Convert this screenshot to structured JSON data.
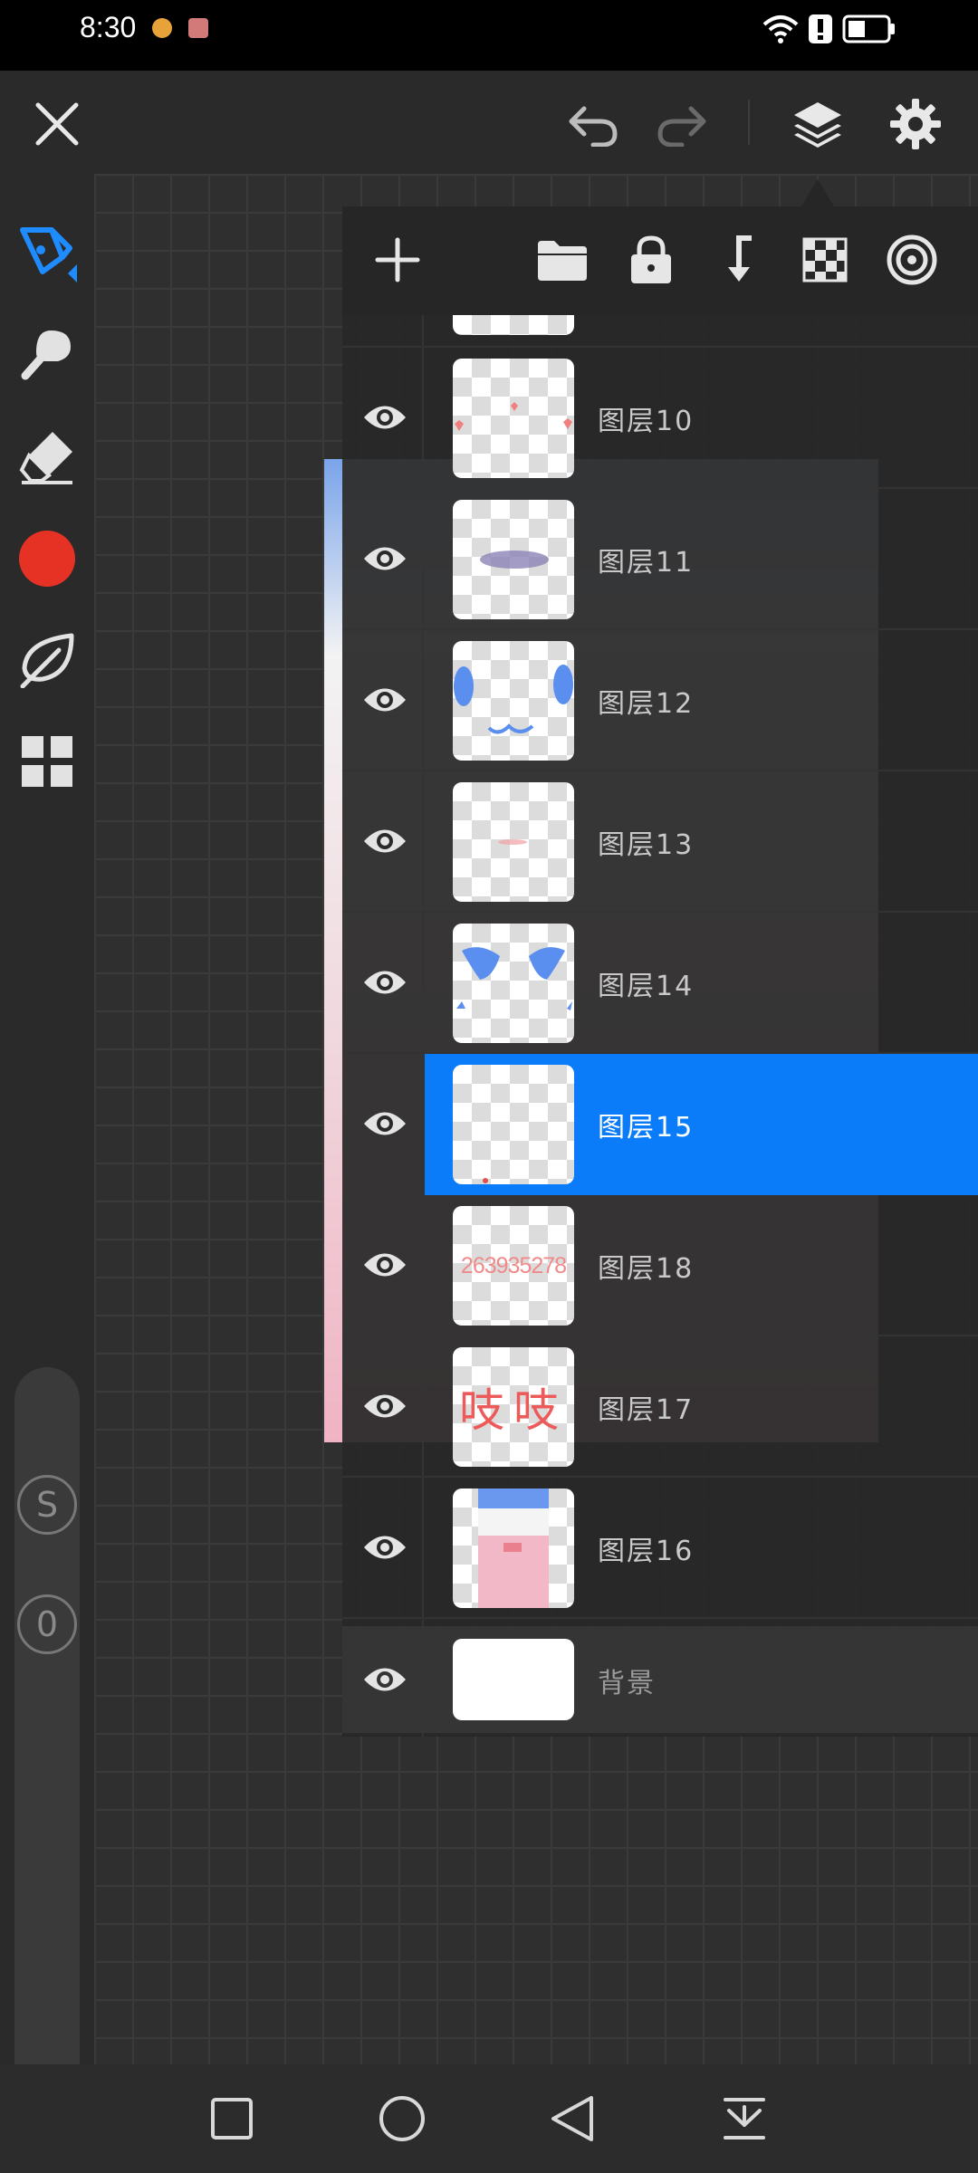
{
  "status_bar": {
    "time": "8:30"
  },
  "toolbar": {
    "close_icon": "close-icon",
    "undo_icon": "undo-icon",
    "redo_icon": "redo-icon",
    "layers_icon": "layers-icon",
    "settings_icon": "gear-icon"
  },
  "tools": {
    "brush_color": "#e53225",
    "circle_s_label": "S",
    "circle_0_label": "0"
  },
  "layers_panel": {
    "actions": [
      "add-layer",
      "folder",
      "lock",
      "merge-down",
      "transparency",
      "blend"
    ],
    "layers": [
      {
        "name": "图层10",
        "visible": true,
        "selected": false
      },
      {
        "name": "图层11",
        "visible": true,
        "selected": false
      },
      {
        "name": "图层12",
        "visible": true,
        "selected": false
      },
      {
        "name": "图层13",
        "visible": true,
        "selected": false
      },
      {
        "name": "图层14",
        "visible": true,
        "selected": false
      },
      {
        "name": "图层15",
        "visible": true,
        "selected": true
      },
      {
        "name": "图层18",
        "visible": true,
        "selected": false
      },
      {
        "name": "图层17",
        "visible": true,
        "selected": false
      },
      {
        "name": "图层16",
        "visible": true,
        "selected": false
      }
    ],
    "background_layer": {
      "name": "背景",
      "visible": true
    },
    "thumb_texts": {
      "layer18": "263935278",
      "layer17": "吱吱"
    },
    "selected_color": "#0a7cf9"
  }
}
